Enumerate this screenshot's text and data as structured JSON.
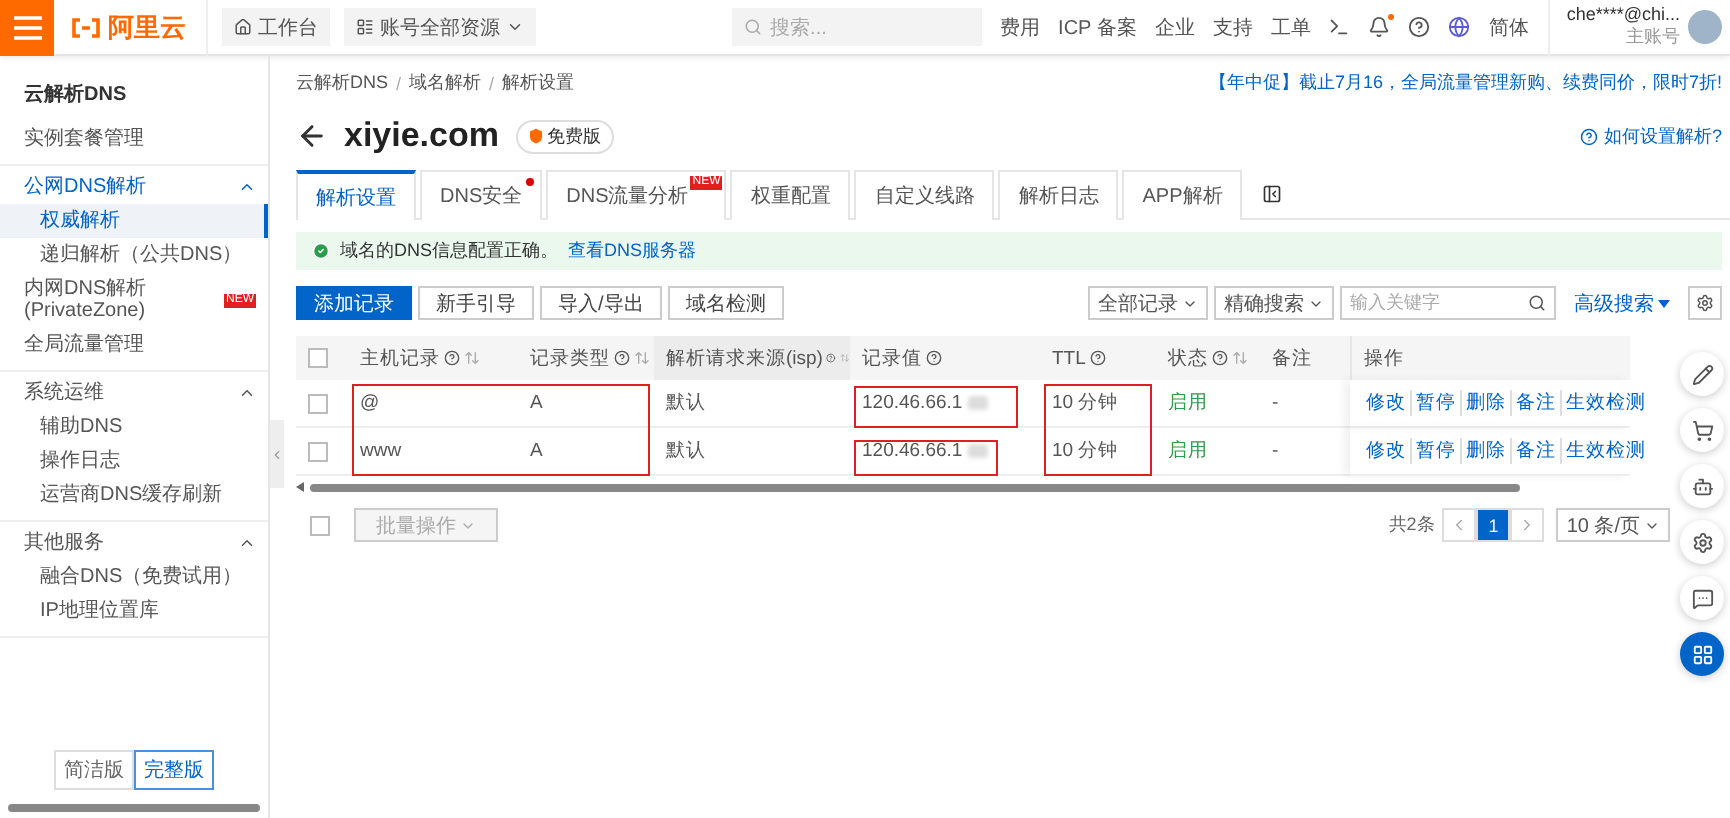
{
  "topbar": {
    "brand": "阿里云",
    "workbench": "工作台",
    "resources": "账号全部资源",
    "search_placeholder": "搜索...",
    "links": [
      "费用",
      "ICP 备案",
      "企业",
      "支持",
      "工单"
    ],
    "notification_unread": true,
    "language": "简体",
    "account": "che****@chi...",
    "account_role": "主账号"
  },
  "sidebar": {
    "title": "云解析DNS",
    "sections": [
      {
        "items": [
          {
            "label": "实例套餐管理",
            "selected": false
          }
        ]
      },
      {
        "items": [
          {
            "label": "公网DNS解析",
            "expanded": true,
            "selected": false,
            "children": [
              {
                "label": "权威解析",
                "selected": true
              },
              {
                "label": "递归解析（公共DNS）",
                "selected": false
              }
            ]
          },
          {
            "label": "内网DNS解析 (PrivateZone)",
            "badge": "NEW",
            "selected": false
          },
          {
            "label": "全局流量管理",
            "selected": false
          }
        ]
      },
      {
        "items": [
          {
            "label": "系统运维",
            "expanded": true,
            "selected": false,
            "children": [
              {
                "label": "辅助DNS",
                "selected": false
              },
              {
                "label": "操作日志",
                "selected": false
              },
              {
                "label": "运营商DNS缓存刷新",
                "selected": false
              }
            ]
          }
        ]
      },
      {
        "items": [
          {
            "label": "其他服务",
            "expanded": true,
            "selected": false,
            "children": [
              {
                "label": "融合DNS（免费试用）",
                "selected": false
              },
              {
                "label": "IP地理位置库",
                "selected": false
              }
            ]
          }
        ]
      }
    ],
    "modes": [
      {
        "label": "简洁版",
        "selected": false
      },
      {
        "label": "完整版",
        "selected": true
      }
    ]
  },
  "breadcrumb": [
    "云解析DNS",
    "域名解析",
    "解析设置"
  ],
  "breadcrumb_separator": "/",
  "promo": "【年中促】截止7月16，全局流量管理新购、续费同价，限时7折!",
  "domain": {
    "name": "xiyie.com",
    "plan": "免费版"
  },
  "help_link": "如何设置解析?",
  "tabs": [
    {
      "label": "解析设置",
      "selected": true
    },
    {
      "label": "DNS安全",
      "selected": false,
      "dot": true
    },
    {
      "label": "DNS流量分析",
      "selected": false,
      "badge": "NEW"
    },
    {
      "label": "权重配置",
      "selected": false
    },
    {
      "label": "自定义线路",
      "selected": false
    },
    {
      "label": "解析日志",
      "selected": false
    },
    {
      "label": "APP解析",
      "selected": false
    }
  ],
  "notice": {
    "text": "域名的DNS信息配置正确。",
    "link": "查看DNS服务器"
  },
  "toolbar": {
    "buttons": [
      {
        "label": "添加记录",
        "kind": "primary"
      },
      {
        "label": "新手引导",
        "kind": "default"
      },
      {
        "label": "导入/导出",
        "kind": "default"
      },
      {
        "label": "域名检测",
        "kind": "default"
      }
    ],
    "filter": "全部记录",
    "search_mode": "精确搜索",
    "search_placeholder": "输入关键字",
    "advanced": "高级搜索"
  },
  "table": {
    "select_all": {
      "checked": false
    },
    "columns": [
      {
        "label": "主机记录",
        "help": true,
        "sortable": true
      },
      {
        "label": "记录类型",
        "help": true,
        "sortable": true
      },
      {
        "label": "解析请求来源(isp)",
        "help": true,
        "sortable": true
      },
      {
        "label": "记录值",
        "help": true,
        "sortable": false
      },
      {
        "label": "TTL",
        "help": true,
        "sortable": false
      },
      {
        "label": "状态",
        "help": true,
        "sortable": true
      },
      {
        "label": "备注",
        "help": false,
        "sortable": false
      },
      {
        "label": "操作",
        "help": false,
        "sortable": false
      }
    ],
    "rows": [
      {
        "checked": false,
        "host": "@",
        "type": "A",
        "isp": "默认",
        "value": "120.46.66.1",
        "ttl": "10 分钟",
        "status": "启用",
        "remark": "-",
        "actions": [
          "修改",
          "暂停",
          "删除",
          "备注",
          "生效检测"
        ]
      },
      {
        "checked": false,
        "host": "www",
        "type": "A",
        "isp": "默认",
        "value": "120.46.66.1",
        "ttl": "10 分钟",
        "status": "启用",
        "remark": "-",
        "actions": [
          "修改",
          "暂停",
          "删除",
          "备注",
          "生效检测"
        ]
      }
    ]
  },
  "footer": {
    "select_all": {
      "checked": false
    },
    "bulk": "批量操作",
    "total": "共2条",
    "pages": [
      {
        "label": "1",
        "selected": true
      }
    ],
    "page_size": "10 条/页"
  }
}
